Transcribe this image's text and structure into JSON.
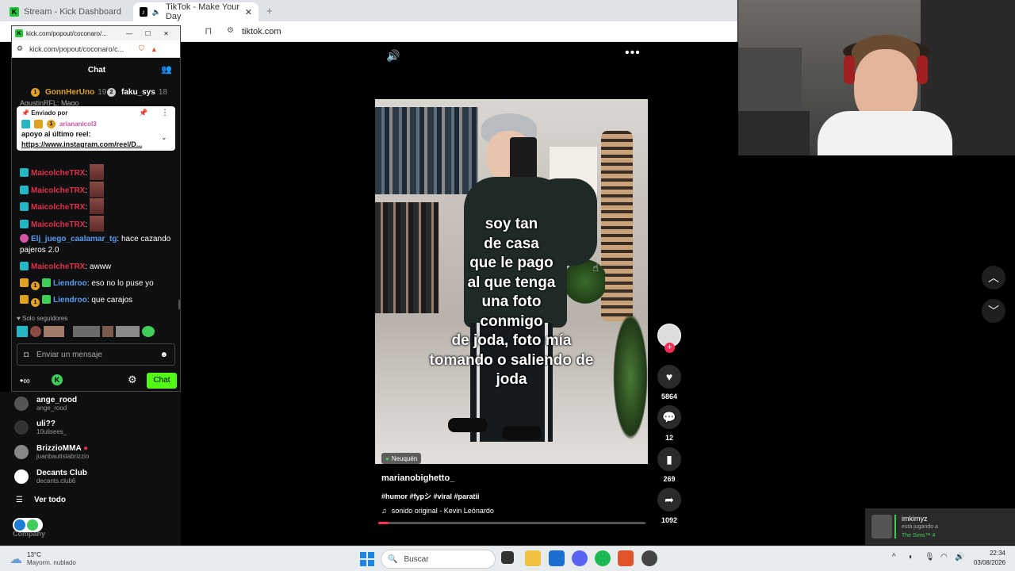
{
  "browser": {
    "tabs": [
      {
        "label": "Stream - Kick Dashboard"
      },
      {
        "label": "TikTok - Make Your Day"
      }
    ],
    "address": "tiktok.com"
  },
  "popout": {
    "url_title": "kick.com/popout/coconaro/...",
    "url": "kick.com/popout/coconaro/c...",
    "chat_title": "Chat",
    "top_users": [
      {
        "name": "GonnHerUno",
        "count": "19"
      },
      {
        "name": "faku_sys",
        "count": "18"
      }
    ],
    "partial_line": "AgustinRFL: Mago",
    "pinned": {
      "header": "Enviado por",
      "user": "ariananicol3",
      "text": "apoyo al último reel:",
      "link": "https://www.instagram.com/reel/D..."
    },
    "messages": [
      {
        "user": "MaicolcheTRX",
        "text": ":"
      },
      {
        "user": "MaicolcheTRX",
        "text": ":"
      },
      {
        "user": "MaicolcheTRX",
        "text": ":"
      },
      {
        "user": "MaicolcheTRX",
        "text": ":"
      },
      {
        "user": "Elj_juego_caalamar_tg",
        "text": ": hace cazando pajeros 2.0"
      },
      {
        "user": "MaicolcheTRX",
        "text": ": awww"
      },
      {
        "user": "Liendroo",
        "text": ": eso no lo puse yo"
      },
      {
        "user": "Liendroo",
        "text": ": que carajos"
      }
    ],
    "followers_only": "Solo seguidores",
    "input_placeholder": "Enviar un mensaje",
    "chat_button": "Chat",
    "accent": "#53fc18"
  },
  "kick_sidebar": {
    "items": [
      {
        "name": "ange_rood",
        "sub": "ange_rood"
      },
      {
        "name": "uli??",
        "sub": "10ulisees_"
      },
      {
        "name": "BrizzioMMA",
        "sub": "juanbautistabrizzio"
      },
      {
        "name": "Decants Club",
        "sub": "decants.club6"
      }
    ],
    "see_all": "Ver todo",
    "company": "Company"
  },
  "tiktok": {
    "overlay_lines": [
      "soy tan",
      "de casa",
      "que le pago",
      "al que tenga",
      "una foto",
      "conmigo",
      "de joda, foto mía",
      "tomando o saliendo de",
      "joda"
    ],
    "location": "Neuquén",
    "author": "marianobighetto_",
    "hashtags": "#humor #fypシ #viral #paratii",
    "sound": "sonido original - Kevin Leónardo",
    "likes": "5864",
    "comments": "12",
    "saves": "269",
    "shares": "1092"
  },
  "notification": {
    "user": "imkimyz",
    "status": "está jugando a",
    "game": "The Sims™ 4"
  },
  "taskbar": {
    "weather_temp": "13°C",
    "weather_desc": "Mayorm. nublado",
    "search_placeholder": "Buscar",
    "time": "22:34",
    "date": "03/08/2026"
  }
}
